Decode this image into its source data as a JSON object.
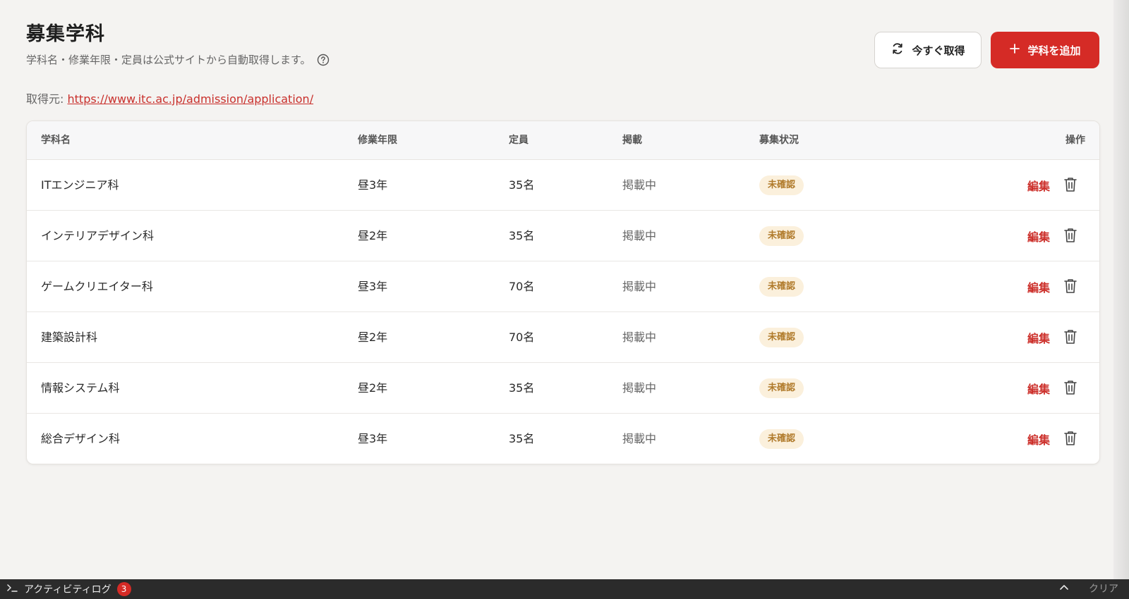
{
  "header": {
    "title": "募集学科",
    "subtitle": "学科名・修業年限・定員は公式サイトから自動取得します。",
    "help_icon": "question-circle-icon",
    "source_label": "取得元:",
    "source_url": "https://www.itc.ac.jp/admission/application/"
  },
  "actions": {
    "fetch_label": "今すぐ取得",
    "fetch_icon": "refresh-icon",
    "add_label": "学科を追加",
    "add_icon": "plus-icon"
  },
  "table": {
    "columns": [
      "学科名",
      "修業年限",
      "定員",
      "掲載",
      "募集状況",
      "操作"
    ],
    "rows": [
      {
        "name": "ITエンジニア科",
        "years": "昼3年",
        "capacity": "35名",
        "published": "掲載中",
        "status": "未確認",
        "edit": "編集"
      },
      {
        "name": "インテリアデザイン科",
        "years": "昼2年",
        "capacity": "35名",
        "published": "掲載中",
        "status": "未確認",
        "edit": "編集"
      },
      {
        "name": "ゲームクリエイター科",
        "years": "昼3年",
        "capacity": "70名",
        "published": "掲載中",
        "status": "未確認",
        "edit": "編集"
      },
      {
        "name": "建築設計科",
        "years": "昼2年",
        "capacity": "70名",
        "published": "掲載中",
        "status": "未確認",
        "edit": "編集"
      },
      {
        "name": "情報システム科",
        "years": "昼2年",
        "capacity": "35名",
        "published": "掲載中",
        "status": "未確認",
        "edit": "編集"
      },
      {
        "name": "総合デザイン科",
        "years": "昼3年",
        "capacity": "35名",
        "published": "掲載中",
        "status": "未確認",
        "edit": "編集"
      }
    ]
  },
  "activity_log": {
    "label": "アクティビティログ",
    "count": "3",
    "clear_label": "クリア",
    "terminal_icon": "terminal-icon",
    "chevron_icon": "chevron-up-icon"
  },
  "colors": {
    "accent": "#d52b26",
    "badge_bg": "#fbf0dc",
    "badge_text": "#b07a2a",
    "background": "#f4f3f1",
    "activity_bar": "#2b2b2b"
  }
}
